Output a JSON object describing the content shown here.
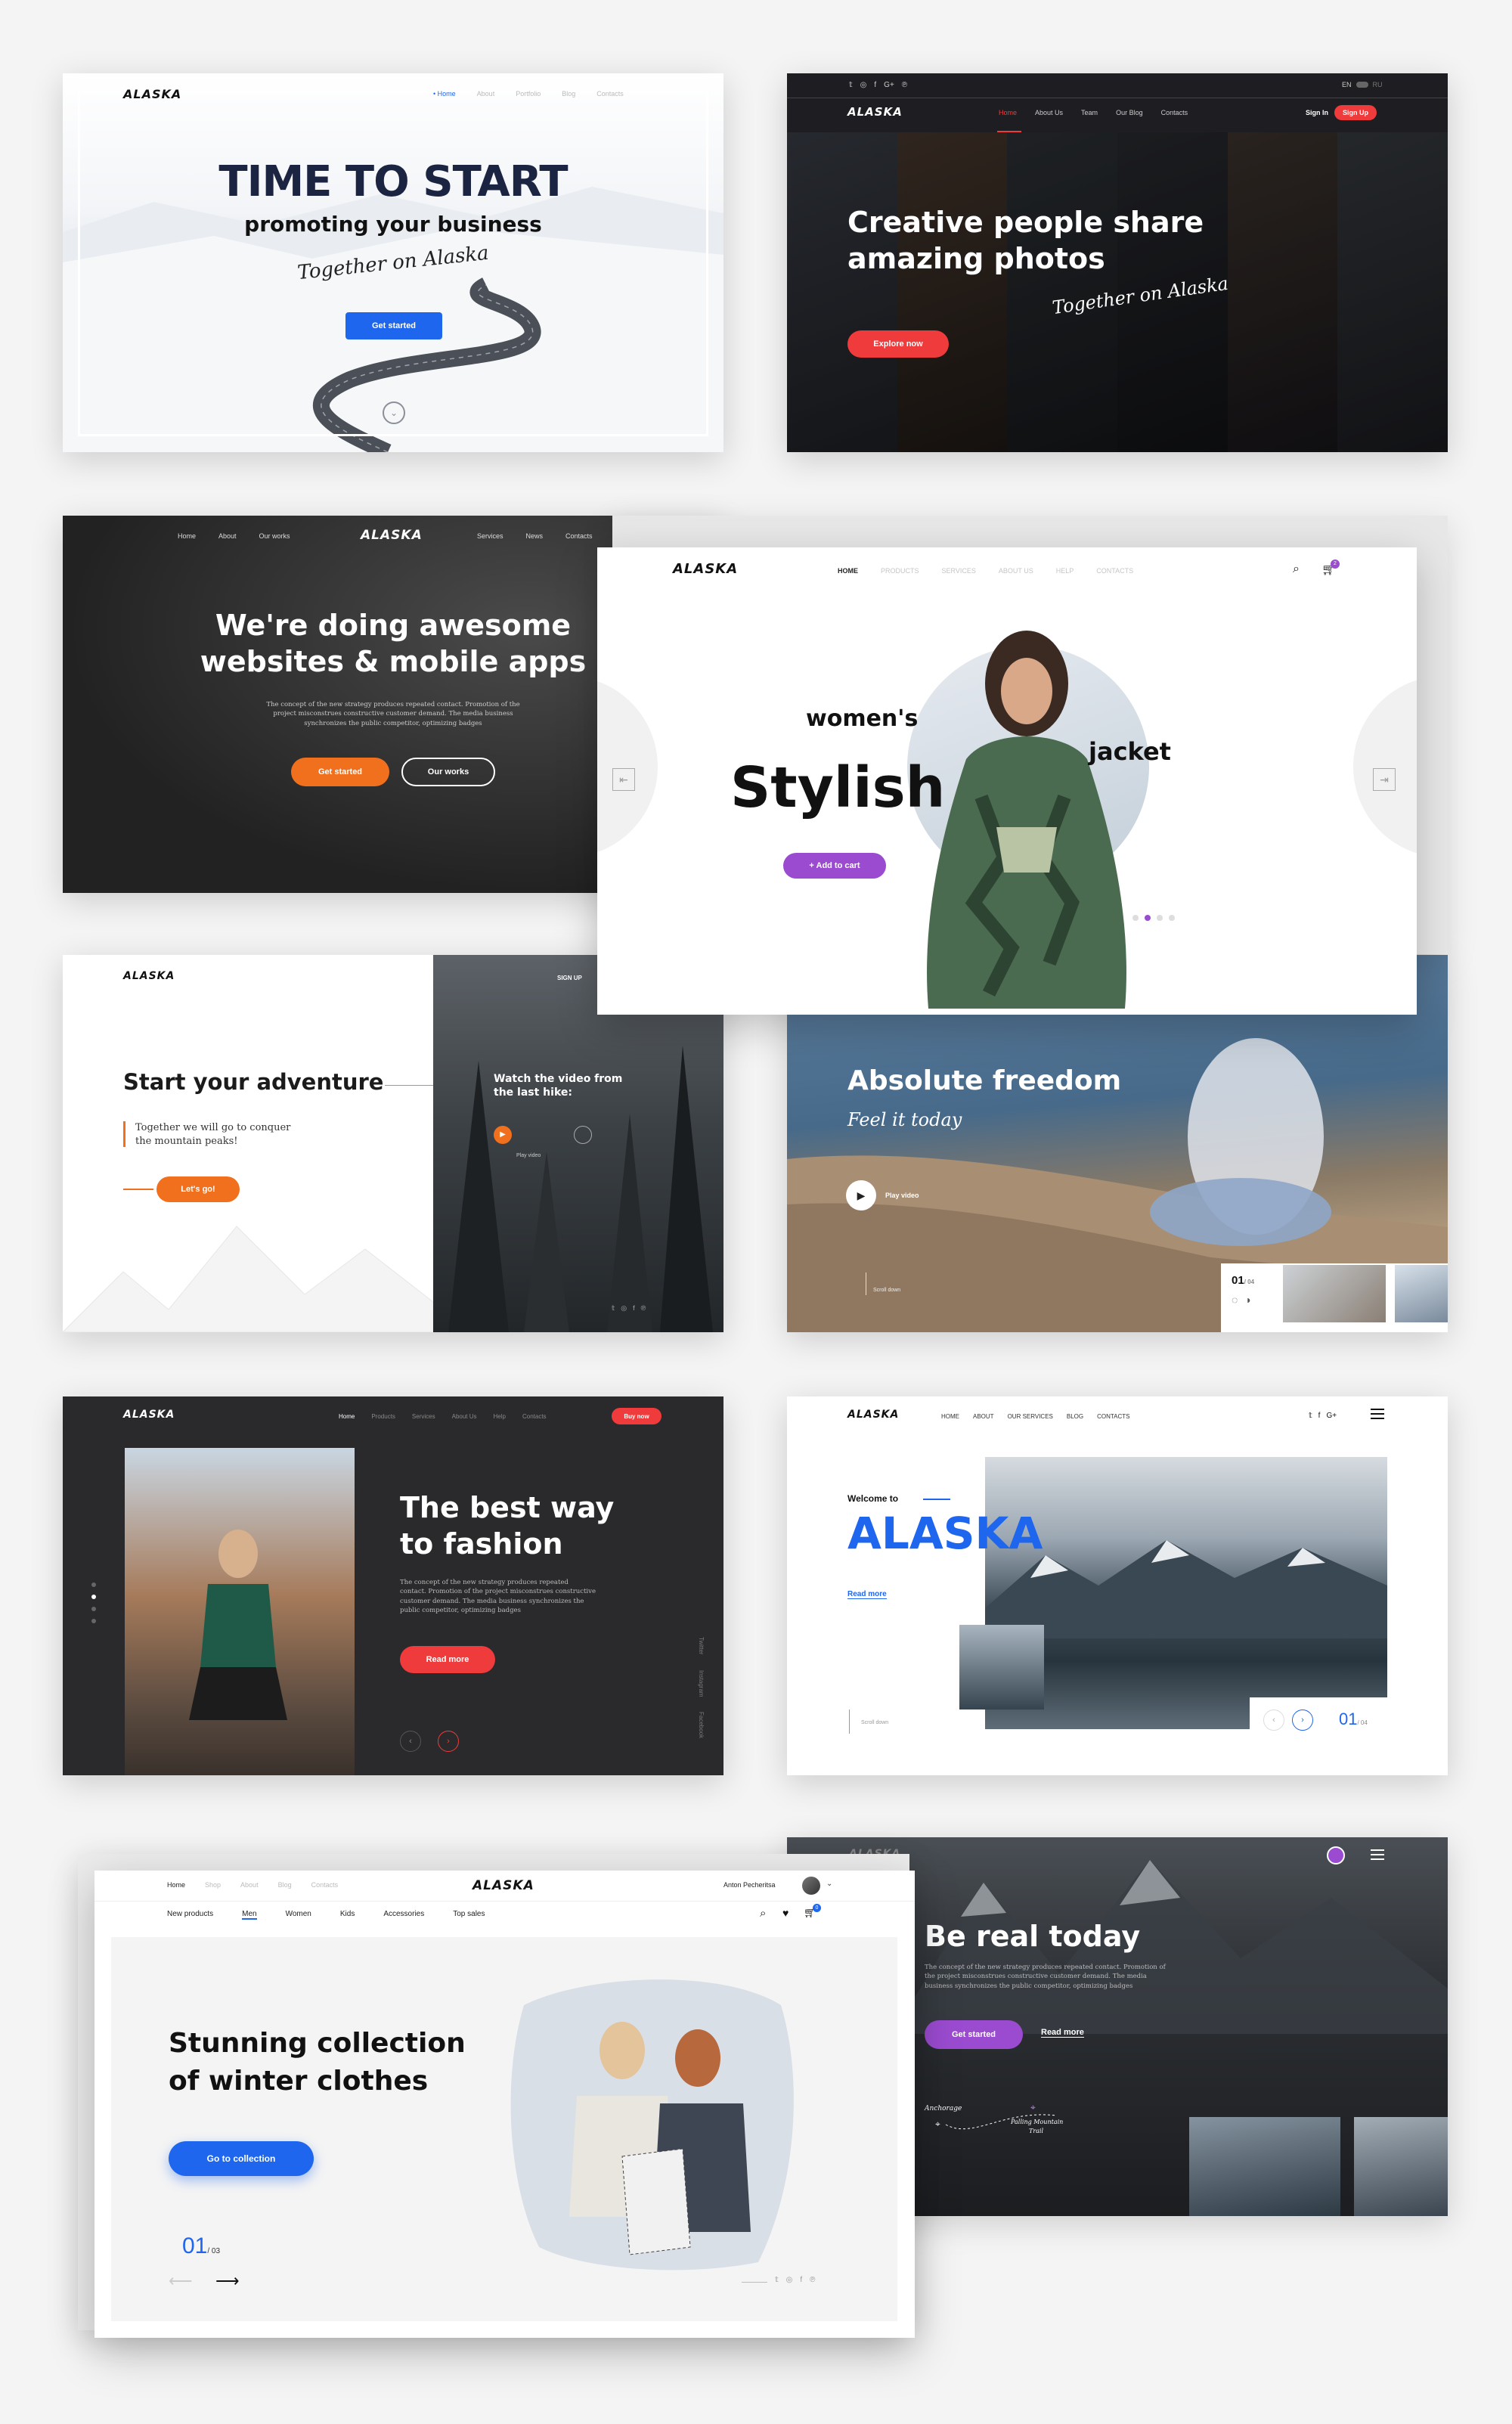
{
  "brand": "ALASKA",
  "colors": {
    "blue": "#1f66ee",
    "red": "#ef3b3b",
    "orange": "#f0701e",
    "purple": "#9b4bd0",
    "dark": "#2b2b2b",
    "navy": "#1d2a4a"
  },
  "m1": {
    "nav": [
      "• Home",
      "About",
      "Portfolio",
      "Blog",
      "Contacts"
    ],
    "title": "TIME TO START",
    "subtitle": "promoting your business",
    "script": "Together on Alaska",
    "cta": "Get started"
  },
  "m2": {
    "lang": [
      "EN",
      "RU"
    ],
    "nav": [
      "Home",
      "About Us",
      "Team",
      "Our Blog",
      "Contacts"
    ],
    "signin": "Sign In",
    "signup": "Sign Up",
    "title1": "Creative people share",
    "title2": "amazing photos",
    "script": "Together on Alaska",
    "cta": "Explore now"
  },
  "m3": {
    "nav_left": [
      "Home",
      "About",
      "Our works"
    ],
    "nav_right": [
      "Services",
      "News",
      "Contacts"
    ],
    "title1": "We're doing awesome",
    "title2": "websites & mobile apps",
    "body": "The concept of the new strategy produces repeated contact. Promotion of the project misconstrues constructive customer demand. The media business synchronizes the public competitor, optimizing badges",
    "cta1": "Get started",
    "cta2": "Our works"
  },
  "m4": {
    "nav": [
      "HOME",
      "PRODUCTS",
      "SERVICES",
      "ABOUT US",
      "HELP",
      "CONTACTS"
    ],
    "cart_count": "2",
    "word1": "women's",
    "word2": "Stylish",
    "word3": "jacket",
    "cta": "+ Add to cart"
  },
  "m5": {
    "signup": "SIGN UP",
    "title": "Start your adventure",
    "quote1": "Together we will go to conquer",
    "quote2": "the mountain peaks!",
    "cta": "Let's go!",
    "video1": "Watch the video from",
    "video2": "the last hike:",
    "play": "Play video"
  },
  "m6": {
    "title": "Absolute freedom",
    "script": "Feel it today",
    "play": "Play video",
    "scroll": "Scroll down",
    "counter": "01",
    "total": "/ 04"
  },
  "m7": {
    "nav": [
      "Home",
      "Products",
      "Services",
      "About Us",
      "Help",
      "Contacts"
    ],
    "cta_nav": "Buy now",
    "title1": "The best way",
    "title2": "to fashion",
    "body": "The concept of the new strategy produces repeated contact. Promotion of the project misconstrues constructive customer demand. The media business synchronizes the public competitor, optimizing badges",
    "cta": "Read more",
    "social": [
      "Twitter",
      "Instagram",
      "Facebook"
    ]
  },
  "m8": {
    "nav": [
      "HOME",
      "ABOUT",
      "OUR SERVICES",
      "BLOG",
      "CONTACTS"
    ],
    "welcome": "Welcome to",
    "big": "ALASKA",
    "read": "Read more",
    "scroll": "Scroll down",
    "counter": "01",
    "total": "/ 04"
  },
  "m9": {
    "nav": [
      "Home",
      "Shop",
      "About",
      "Blog",
      "Contacts"
    ],
    "user": "Anton Pecheritsa",
    "cats": [
      "New products",
      "Men",
      "Women",
      "Kids",
      "Accessories",
      "Top sales"
    ],
    "cart_count": "0",
    "title1": "Stunning collection",
    "title2": "of winter clothes",
    "cta": "Go to collection",
    "counter": "01",
    "total": "/ 03"
  },
  "m10": {
    "brand": "ALASKA",
    "title": "Be real today",
    "body": "The concept of the new strategy produces repeated contact. Promotion of the project misconstrues constructive customer demand. The media business synchronizes the public competitor, optimizing badges",
    "cta": "Get started",
    "read": "Read more",
    "place1": "Anchorage",
    "place2a": "Palling Mountain",
    "place2b": "Trail"
  }
}
